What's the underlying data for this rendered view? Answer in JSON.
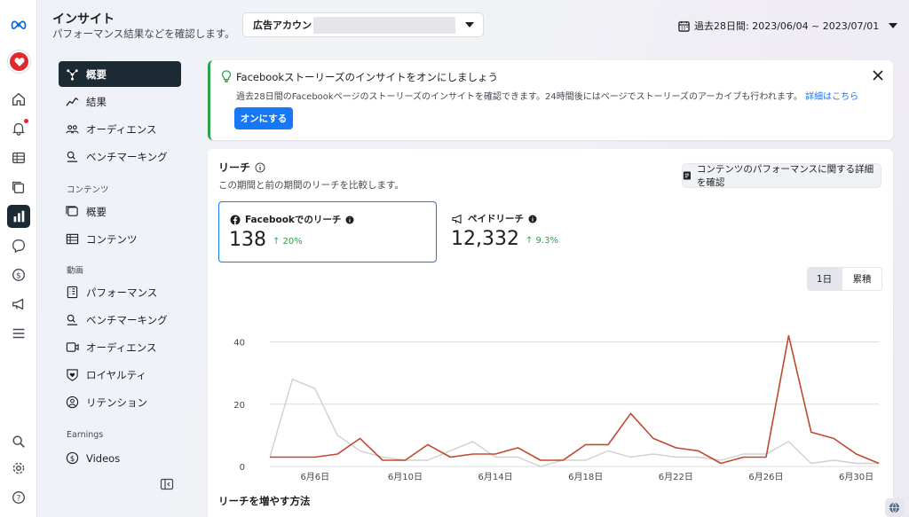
{
  "header": {
    "title": "インサイト",
    "subtitle": "パフォーマンス結果などを確認します。",
    "account_label": "広告アカウント:",
    "date_range": "過去28日間: 2023/06/04 ~ 2023/07/01"
  },
  "rail": {
    "icons": [
      "meta-logo-icon",
      "page-avatar-icon",
      "home-icon",
      "notifications-icon",
      "table-icon",
      "pages-icon",
      "insights-icon",
      "messages-icon",
      "dollar-icon",
      "megaphone-icon",
      "menu-icon",
      "search-icon",
      "settings-icon",
      "help-icon"
    ]
  },
  "nav": {
    "items": [
      {
        "label": "概要",
        "icon": "overview-icon"
      },
      {
        "label": "結果",
        "icon": "results-icon"
      },
      {
        "label": "オーディエンス",
        "icon": "audience-icon"
      },
      {
        "label": "ベンチマーキング",
        "icon": "benchmark-icon"
      }
    ],
    "content_section": "コンテンツ",
    "content_items": [
      {
        "label": "概要",
        "icon": "content-overview-icon"
      },
      {
        "label": "コンテンツ",
        "icon": "content-table-icon"
      }
    ],
    "video_section": "動画",
    "video_items": [
      {
        "label": "パフォーマンス",
        "icon": "performance-icon"
      },
      {
        "label": "ベンチマーキング",
        "icon": "benchmark-icon"
      },
      {
        "label": "オーディエンス",
        "icon": "video-audience-icon"
      },
      {
        "label": "ロイヤルティ",
        "icon": "loyalty-icon"
      },
      {
        "label": "リテンション",
        "icon": "retention-icon"
      }
    ],
    "earnings_section": "Earnings",
    "earnings_items": [
      {
        "label": "Videos",
        "icon": "dollar-icon"
      }
    ]
  },
  "banner": {
    "title": "Facebookストーリーズのインサイトをオンにしましょう",
    "text": "過去28日間のFacebookページのストーリーズのインサイトを確認できます。24時間後にはページでストーリーズのアーカイブも行われます。",
    "link": "詳細はこちら",
    "button": "オンにする"
  },
  "reach": {
    "title": "リーチ",
    "subtitle": "この期間と前の期間のリーチを比較します。",
    "detail_button": "コンテンツのパフォーマンスに関する詳細を確認",
    "metrics": [
      {
        "label": "Facebookでのリーチ",
        "value": "138",
        "change": "↑ 20%"
      },
      {
        "label": "ペイドリーチ",
        "value": "12,332",
        "change": "↑ 9.3%"
      }
    ],
    "toggle": {
      "on": "1日",
      "off": "累積"
    },
    "bottom_title": "リーチを増やす方法"
  },
  "chart_data": {
    "type": "line",
    "x": [
      "6/4",
      "6/5",
      "6/6",
      "6/7",
      "6/8",
      "6/9",
      "6/10",
      "6/11",
      "6/12",
      "6/13",
      "6/14",
      "6/15",
      "6/16",
      "6/17",
      "6/18",
      "6/19",
      "6/20",
      "6/21",
      "6/22",
      "6/23",
      "6/24",
      "6/25",
      "6/26",
      "6/27",
      "6/28",
      "6/29",
      "6/30",
      "7/1"
    ],
    "tick_labels": [
      "6月6日",
      "6月10日",
      "6月14日",
      "6月18日",
      "6月22日",
      "6月26日",
      "6月30日"
    ],
    "tick_positions": [
      "6/6",
      "6/10",
      "6/14",
      "6/18",
      "6/22",
      "6/26",
      "6/30"
    ],
    "y_ticks": [
      0,
      20,
      40
    ],
    "ylim": [
      0,
      45
    ],
    "series": [
      {
        "color": "#c0492f",
        "values": [
          3,
          3,
          3,
          4,
          9,
          2,
          2,
          7,
          3,
          4,
          4,
          6,
          2,
          2,
          7,
          7,
          17,
          9,
          6,
          5,
          1,
          3,
          3,
          42,
          11,
          9,
          4,
          1
        ]
      },
      {
        "color": "#d0d0d0",
        "values": [
          3,
          28,
          25,
          10,
          5,
          3,
          2,
          2,
          5,
          8,
          3,
          3,
          0,
          2,
          2,
          5,
          3,
          4,
          3,
          3,
          2,
          4,
          4,
          8,
          1,
          2,
          1,
          1
        ]
      }
    ]
  }
}
